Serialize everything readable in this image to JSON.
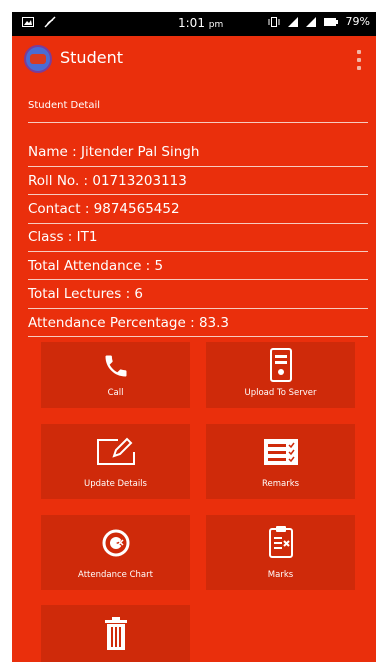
{
  "status_bar": {
    "time": "1:01",
    "time_suffix": "pm",
    "battery": "79%"
  },
  "app_bar": {
    "title": "Student"
  },
  "detail": {
    "section_label": "Student Detail",
    "name": "Name : Jitender Pal Singh",
    "roll": "Roll No. :  01713203113",
    "contact": "Contact : 9874565452",
    "class": "Class : IT1",
    "total_attendance": "Total Attendance : 5",
    "total_lectures": "Total Lectures : 6",
    "attendance_percentage": "Attendance Percentage : 83.3"
  },
  "actions": {
    "call": "Call",
    "upload": "Upload To Server",
    "update": "Update Details",
    "remarks": "Remarks",
    "chart": "Attendance Chart",
    "marks": "Marks"
  },
  "colors": {
    "background": "#ea2f0c",
    "tile": "#cf2a0a",
    "text": "#ffffff"
  }
}
